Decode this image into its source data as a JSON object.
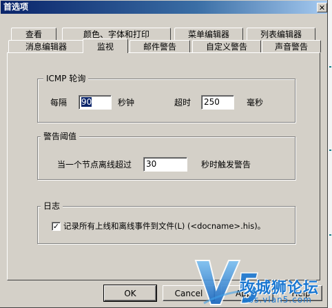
{
  "dialog": {
    "title": "首选项",
    "close_glyph": "✕"
  },
  "tabs_row1": [
    "查看",
    "颜色、字体和打印",
    "菜单编辑器",
    "列表编辑器"
  ],
  "tabs_row2": [
    "消息编辑器",
    "监视",
    "邮件警告",
    "自定义警告",
    "声音警告"
  ],
  "active_tab": "监视",
  "icmp": {
    "legend": "ICMP 轮询",
    "every_label": "每隔",
    "every_value": "90",
    "seconds_label": "秒钟",
    "timeout_label": "超时",
    "timeout_value": "250",
    "ms_label": "毫秒"
  },
  "alarm": {
    "legend": "警告阈值",
    "prefix_label": "当一个节点离线超过",
    "value": "30",
    "suffix_label": "秒时触发警告"
  },
  "log": {
    "legend": "日志",
    "checked": true,
    "check_glyph": "✓",
    "label": "记录所有上线和离线事件到文件(L) (<docname>.his)。"
  },
  "buttons": {
    "ok": "OK",
    "cancel": "Cancel",
    "apply": "Apply",
    "help": "Help"
  },
  "watermark": {
    "logo_text": "V5",
    "site_name": "攻城狮论坛",
    "url": "bbs.vlan5.com"
  }
}
